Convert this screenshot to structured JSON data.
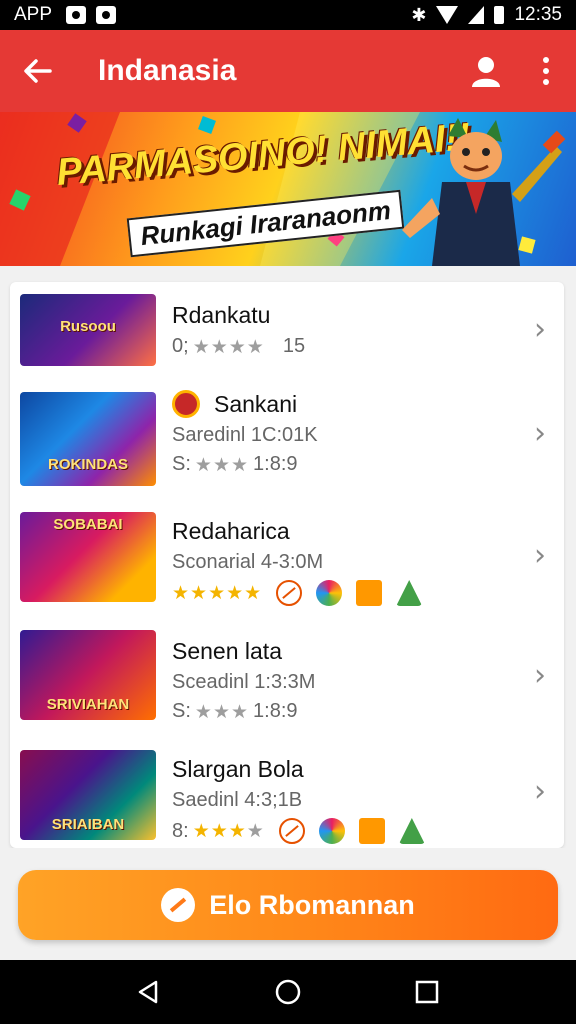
{
  "status_bar": {
    "app_label": "APP",
    "time": "12:35"
  },
  "app_bar": {
    "title": "Indanasia"
  },
  "banner": {
    "headline": "PARMASOINO! NIMAI!!",
    "subline": "Runkagi Iraranaonm"
  },
  "games": [
    {
      "thumb_title": "Rusoou",
      "name": "Rdankatu",
      "meta_prefix": "0;",
      "stars": 4,
      "meta_suffix": "15",
      "has_badge": false,
      "has_extra_icons": false
    },
    {
      "thumb_title": "ROKINDAS",
      "name": "Sankani",
      "subtitle": "Saredinl 1C:01K",
      "meta_prefix": "S:",
      "stars": 3,
      "meta_suffix": "1:8:9",
      "has_badge": true,
      "has_extra_icons": false
    },
    {
      "thumb_title": "SOBABAI",
      "name": "Redaharica",
      "subtitle": "Sconarial 4-3:0M",
      "meta_prefix": "",
      "stars": 5,
      "meta_suffix": "",
      "has_badge": false,
      "has_extra_icons": true
    },
    {
      "thumb_title": "SRIVIAHAN",
      "name": "Senen lata",
      "subtitle": "Sceadinl 1:3:3M",
      "meta_prefix": "S:",
      "stars": 3,
      "meta_suffix": "1:8:9",
      "has_badge": false,
      "has_extra_icons": false
    },
    {
      "thumb_title": "SRIAIBAN",
      "name": "Slargan Bola",
      "subtitle": "Saedinl 4:3;1B",
      "meta_prefix": "8:",
      "stars": 3,
      "meta_suffix": "",
      "has_badge": false,
      "has_extra_icons": true
    }
  ],
  "cta": {
    "label": "Elo Rbomannan"
  },
  "colors": {
    "app_bar": "#e53935",
    "cta_start": "#ffa326",
    "cta_end": "#ff6a12",
    "star_on": "#f4b400",
    "star_off": "#9e9e9e"
  },
  "icons": {
    "back": "arrow-left-icon",
    "profile": "person-icon",
    "more": "more-vert-icon",
    "chevron": "chevron-right-icon"
  }
}
